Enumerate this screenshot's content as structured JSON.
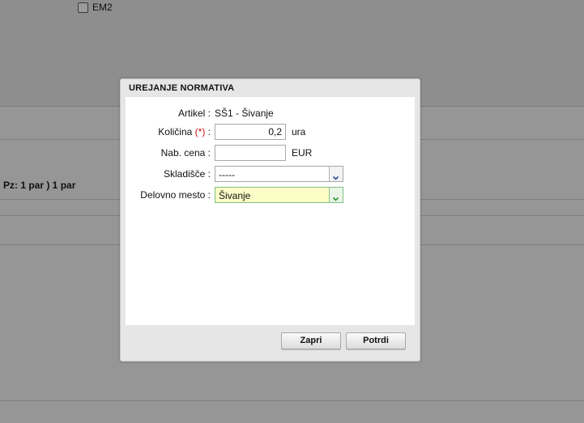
{
  "background": {
    "checkbox_label": "EM2",
    "pz_text": "Pz: 1 par ) 1 par"
  },
  "dialog": {
    "title": "UREJANJE NORMATIVA",
    "fields": {
      "artikel": {
        "label": "Artikel :",
        "value": "SŠ1 - Šivanje"
      },
      "kolicina": {
        "label_prefix": "Količina ",
        "required_mark": "(*)",
        "label_suffix": " :",
        "value": "0,2",
        "unit": "ura"
      },
      "nab_cena": {
        "label": "Nab. cena :",
        "value": "",
        "unit": "EUR"
      },
      "skladisce": {
        "label": "Skladišče :",
        "value": "-----"
      },
      "delovno_mesto": {
        "label": "Delovno mesto :",
        "value": "Šivanje"
      }
    },
    "buttons": {
      "close": "Zapri",
      "confirm": "Potrdi"
    }
  },
  "colors": {
    "required": "#d01010",
    "highlight_select": "#fdfdc8",
    "select_arrow_blue": "#2a4f9a",
    "select_arrow_green": "#2f8f2f"
  },
  "icons": {
    "dropdown_default": "chevron-down-icon",
    "dropdown_highlight": "chevron-down-icon"
  }
}
